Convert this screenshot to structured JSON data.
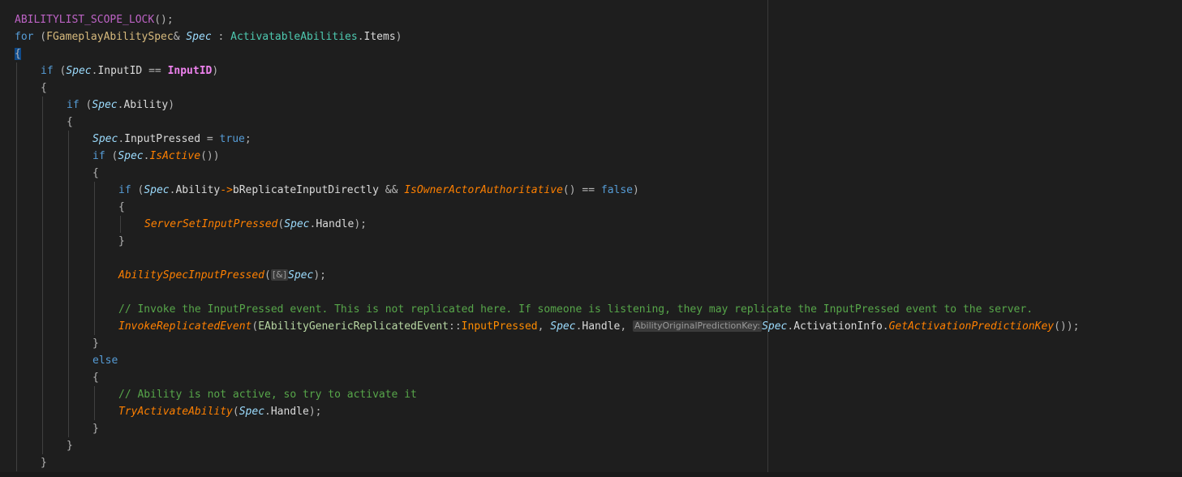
{
  "editor": {
    "lines": [
      {
        "indent": 0,
        "segments": [
          [
            "macro",
            "ABILITYLIST_SCOPE_LOCK"
          ],
          [
            "op",
            "();"
          ]
        ]
      },
      {
        "indent": 0,
        "segments": [
          [
            "kw",
            "for"
          ],
          [
            "op",
            " ("
          ],
          [
            "typeY",
            "FGameplayAbilitySpec"
          ],
          [
            "op",
            "& "
          ],
          [
            "param",
            "Spec"
          ],
          [
            "op",
            " : "
          ],
          [
            "type",
            "ActivatableAbilities"
          ],
          [
            "op",
            "."
          ],
          [
            "member",
            "Items"
          ],
          [
            "op",
            ")"
          ]
        ]
      },
      {
        "indent": 0,
        "segments": [
          [
            "brace",
            "{"
          ]
        ]
      },
      {
        "indent": 1,
        "segments": [
          [
            "kw",
            "if"
          ],
          [
            "op",
            " ("
          ],
          [
            "param",
            "Spec"
          ],
          [
            "op",
            "."
          ],
          [
            "member",
            "InputID"
          ],
          [
            "op",
            " == "
          ],
          [
            "mac2",
            "InputID"
          ],
          [
            "op",
            ")"
          ]
        ]
      },
      {
        "indent": 1,
        "segments": [
          [
            "op",
            "{"
          ]
        ]
      },
      {
        "indent": 2,
        "segments": [
          [
            "kw",
            "if"
          ],
          [
            "op",
            " ("
          ],
          [
            "param",
            "Spec"
          ],
          [
            "op",
            "."
          ],
          [
            "member",
            "Ability"
          ],
          [
            "op",
            ")"
          ]
        ]
      },
      {
        "indent": 2,
        "segments": [
          [
            "op",
            "{"
          ]
        ]
      },
      {
        "indent": 3,
        "segments": [
          [
            "param",
            "Spec"
          ],
          [
            "op",
            "."
          ],
          [
            "member",
            "InputPressed"
          ],
          [
            "op",
            " = "
          ],
          [
            "kw",
            "true"
          ],
          [
            "op",
            ";"
          ]
        ]
      },
      {
        "indent": 3,
        "segments": [
          [
            "kw",
            "if"
          ],
          [
            "op",
            " ("
          ],
          [
            "param",
            "Spec"
          ],
          [
            "op",
            "."
          ],
          [
            "fn",
            "IsActive"
          ],
          [
            "op",
            "())"
          ]
        ]
      },
      {
        "indent": 3,
        "segments": [
          [
            "op",
            "{"
          ]
        ]
      },
      {
        "indent": 4,
        "segments": [
          [
            "kw",
            "if"
          ],
          [
            "op",
            " ("
          ],
          [
            "param",
            "Spec"
          ],
          [
            "op",
            "."
          ],
          [
            "member",
            "Ability"
          ],
          [
            "arrow",
            "->"
          ],
          [
            "member",
            "bReplicateInputDirectly"
          ],
          [
            "op",
            " && "
          ],
          [
            "fn",
            "IsOwnerActorAuthoritative"
          ],
          [
            "op",
            "() == "
          ],
          [
            "kw",
            "false"
          ],
          [
            "op",
            ")"
          ]
        ]
      },
      {
        "indent": 4,
        "segments": [
          [
            "op",
            "{"
          ]
        ]
      },
      {
        "indent": 5,
        "segments": [
          [
            "fn",
            "ServerSetInputPressed"
          ],
          [
            "op",
            "("
          ],
          [
            "param",
            "Spec"
          ],
          [
            "op",
            "."
          ],
          [
            "member",
            "Handle"
          ],
          [
            "op",
            ");"
          ]
        ]
      },
      {
        "indent": 4,
        "segments": [
          [
            "op",
            "}"
          ]
        ]
      },
      {
        "indent": 4,
        "segments": []
      },
      {
        "indent": 4,
        "segments": [
          [
            "fn",
            "AbilitySpecInputPressed"
          ],
          [
            "op",
            "("
          ],
          [
            "hint",
            "[&]"
          ],
          [
            "param",
            "Spec"
          ],
          [
            "op",
            ");"
          ]
        ]
      },
      {
        "indent": 4,
        "segments": []
      },
      {
        "indent": 4,
        "segments": [
          [
            "cm",
            "// Invoke the InputPressed event. This is not replicated here. If someone is listening, they may replicate the InputPressed event to the server."
          ]
        ]
      },
      {
        "indent": 4,
        "segments": [
          [
            "fn",
            "InvokeReplicatedEvent"
          ],
          [
            "op",
            "("
          ],
          [
            "enum",
            "EAbilityGenericReplicatedEvent"
          ],
          [
            "op",
            "::"
          ],
          [
            "enumval",
            "InputPressed"
          ],
          [
            "op",
            ", "
          ],
          [
            "param",
            "Spec"
          ],
          [
            "op",
            "."
          ],
          [
            "member",
            "Handle"
          ],
          [
            "op",
            ", "
          ],
          [
            "hint",
            "AbilityOriginalPredictionKey:"
          ],
          [
            "param",
            "Spec"
          ],
          [
            "op",
            "."
          ],
          [
            "member",
            "ActivationInfo"
          ],
          [
            "op",
            "."
          ],
          [
            "fn",
            "GetActivationPredictionKey"
          ],
          [
            "op",
            "());"
          ]
        ]
      },
      {
        "indent": 3,
        "segments": [
          [
            "op",
            "}"
          ]
        ]
      },
      {
        "indent": 3,
        "segments": [
          [
            "kw",
            "else"
          ]
        ]
      },
      {
        "indent": 3,
        "segments": [
          [
            "op",
            "{"
          ]
        ]
      },
      {
        "indent": 4,
        "segments": [
          [
            "cm",
            "// Ability is not active, so try to activate it"
          ]
        ]
      },
      {
        "indent": 4,
        "segments": [
          [
            "fn",
            "TryActivateAbility"
          ],
          [
            "op",
            "("
          ],
          [
            "param",
            "Spec"
          ],
          [
            "op",
            "."
          ],
          [
            "member",
            "Handle"
          ],
          [
            "op",
            ");"
          ]
        ]
      },
      {
        "indent": 3,
        "segments": [
          [
            "op",
            "}"
          ]
        ]
      },
      {
        "indent": 2,
        "segments": [
          [
            "op",
            "}"
          ]
        ]
      },
      {
        "indent": 1,
        "segments": [
          [
            "op",
            "}"
          ]
        ]
      }
    ]
  }
}
